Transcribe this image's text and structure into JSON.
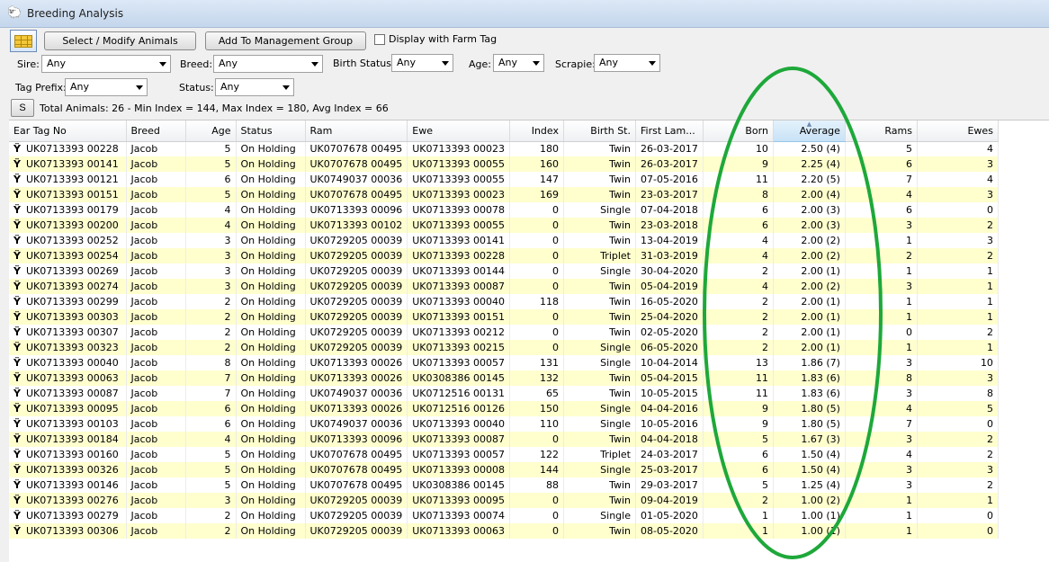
{
  "window": {
    "title": "Breeding Analysis"
  },
  "toolbar": {
    "select_label": "Select / Modify Animals",
    "add_group_label": "Add To Management Group",
    "farm_tag_label": "Display with Farm Tag"
  },
  "filters": {
    "sire_label": "Sire:",
    "sire_value": "Any",
    "breed_label": "Breed:",
    "breed_value": "Any",
    "birth_status_label": "Birth Status:",
    "birth_status_value": "Any",
    "age_label": "Age:",
    "age_value": "Any",
    "scrapie_label": "Scrapie:",
    "scrapie_value": "Any",
    "tag_prefix_label": "Tag Prefix:",
    "tag_prefix_value": "Any",
    "status_label": "Status:",
    "status_value": "Any"
  },
  "summary": {
    "s_button": "S",
    "text": "Total Animals: 26 - Min Index = 144, Max Index = 180, Avg Index = 66"
  },
  "table": {
    "columns": [
      "Ear Tag No",
      "Breed",
      "Age",
      "Status",
      "Ram",
      "Ewe",
      "Index",
      "Birth St.",
      "First Lam...",
      "Born",
      "Average",
      "Rams",
      "Ewes"
    ],
    "rows": [
      [
        "UK0713393 00228",
        "Jacob",
        "5",
        "On Holding",
        "UK0707678 00495",
        "UK0713393 00023",
        "180",
        "Twin",
        "26-03-2017",
        "10",
        "2.50 (4)",
        "5",
        "4"
      ],
      [
        "UK0713393 00141",
        "Jacob",
        "5",
        "On Holding",
        "UK0707678 00495",
        "UK0713393 00055",
        "160",
        "Twin",
        "26-03-2017",
        "9",
        "2.25 (4)",
        "6",
        "3"
      ],
      [
        "UK0713393 00121",
        "Jacob",
        "6",
        "On Holding",
        "UK0749037 00036",
        "UK0713393 00055",
        "147",
        "Twin",
        "07-05-2016",
        "11",
        "2.20 (5)",
        "7",
        "4"
      ],
      [
        "UK0713393 00151",
        "Jacob",
        "5",
        "On Holding",
        "UK0707678 00495",
        "UK0713393 00023",
        "169",
        "Twin",
        "23-03-2017",
        "8",
        "2.00 (4)",
        "4",
        "3"
      ],
      [
        "UK0713393 00179",
        "Jacob",
        "4",
        "On Holding",
        "UK0713393 00096",
        "UK0713393 00078",
        "0",
        "Single",
        "07-04-2018",
        "6",
        "2.00 (3)",
        "6",
        "0"
      ],
      [
        "UK0713393 00200",
        "Jacob",
        "4",
        "On Holding",
        "UK0713393 00102",
        "UK0713393 00055",
        "0",
        "Twin",
        "23-03-2018",
        "6",
        "2.00 (3)",
        "3",
        "2"
      ],
      [
        "UK0713393 00252",
        "Jacob",
        "3",
        "On Holding",
        "UK0729205 00039",
        "UK0713393 00141",
        "0",
        "Twin",
        "13-04-2019",
        "4",
        "2.00 (2)",
        "1",
        "3"
      ],
      [
        "UK0713393 00254",
        "Jacob",
        "3",
        "On Holding",
        "UK0729205 00039",
        "UK0713393 00228",
        "0",
        "Triplet",
        "31-03-2019",
        "4",
        "2.00 (2)",
        "2",
        "2"
      ],
      [
        "UK0713393 00269",
        "Jacob",
        "3",
        "On Holding",
        "UK0729205 00039",
        "UK0713393 00144",
        "0",
        "Single",
        "30-04-2020",
        "2",
        "2.00 (1)",
        "1",
        "1"
      ],
      [
        "UK0713393 00274",
        "Jacob",
        "3",
        "On Holding",
        "UK0729205 00039",
        "UK0713393 00087",
        "0",
        "Twin",
        "05-04-2019",
        "4",
        "2.00 (2)",
        "3",
        "1"
      ],
      [
        "UK0713393 00299",
        "Jacob",
        "2",
        "On Holding",
        "UK0729205 00039",
        "UK0713393 00040",
        "118",
        "Twin",
        "16-05-2020",
        "2",
        "2.00 (1)",
        "1",
        "1"
      ],
      [
        "UK0713393 00303",
        "Jacob",
        "2",
        "On Holding",
        "UK0729205 00039",
        "UK0713393 00151",
        "0",
        "Twin",
        "25-04-2020",
        "2",
        "2.00 (1)",
        "1",
        "1"
      ],
      [
        "UK0713393 00307",
        "Jacob",
        "2",
        "On Holding",
        "UK0729205 00039",
        "UK0713393 00212",
        "0",
        "Twin",
        "02-05-2020",
        "2",
        "2.00 (1)",
        "0",
        "2"
      ],
      [
        "UK0713393 00323",
        "Jacob",
        "2",
        "On Holding",
        "UK0729205 00039",
        "UK0713393 00215",
        "0",
        "Single",
        "06-05-2020",
        "2",
        "2.00 (1)",
        "1",
        "1"
      ],
      [
        "UK0713393 00040",
        "Jacob",
        "8",
        "On Holding",
        "UK0713393 00026",
        "UK0713393 00057",
        "131",
        "Single",
        "10-04-2014",
        "13",
        "1.86 (7)",
        "3",
        "10"
      ],
      [
        "UK0713393 00063",
        "Jacob",
        "7",
        "On Holding",
        "UK0713393 00026",
        "UK0308386 00145",
        "132",
        "Twin",
        "05-04-2015",
        "11",
        "1.83 (6)",
        "8",
        "3"
      ],
      [
        "UK0713393 00087",
        "Jacob",
        "7",
        "On Holding",
        "UK0749037 00036",
        "UK0712516 00131",
        "65",
        "Twin",
        "10-05-2015",
        "11",
        "1.83 (6)",
        "3",
        "8"
      ],
      [
        "UK0713393 00095",
        "Jacob",
        "6",
        "On Holding",
        "UK0713393 00026",
        "UK0712516 00126",
        "150",
        "Single",
        "04-04-2016",
        "9",
        "1.80 (5)",
        "4",
        "5"
      ],
      [
        "UK0713393 00103",
        "Jacob",
        "6",
        "On Holding",
        "UK0749037 00036",
        "UK0713393 00040",
        "110",
        "Single",
        "10-05-2016",
        "9",
        "1.80 (5)",
        "7",
        "0"
      ],
      [
        "UK0713393 00184",
        "Jacob",
        "4",
        "On Holding",
        "UK0713393 00096",
        "UK0713393 00087",
        "0",
        "Twin",
        "04-04-2018",
        "5",
        "1.67 (3)",
        "3",
        "2"
      ],
      [
        "UK0713393 00160",
        "Jacob",
        "5",
        "On Holding",
        "UK0707678 00495",
        "UK0713393 00057",
        "122",
        "Triplet",
        "24-03-2017",
        "6",
        "1.50 (4)",
        "4",
        "2"
      ],
      [
        "UK0713393 00326",
        "Jacob",
        "5",
        "On Holding",
        "UK0707678 00495",
        "UK0713393 00008",
        "144",
        "Single",
        "25-03-2017",
        "6",
        "1.50 (4)",
        "3",
        "3"
      ],
      [
        "UK0713393 00146",
        "Jacob",
        "5",
        "On Holding",
        "UK0707678 00495",
        "UK0308386 00145",
        "88",
        "Twin",
        "29-03-2017",
        "5",
        "1.25 (4)",
        "3",
        "2"
      ],
      [
        "UK0713393 00276",
        "Jacob",
        "3",
        "On Holding",
        "UK0729205 00039",
        "UK0713393 00095",
        "0",
        "Twin",
        "09-04-2019",
        "2",
        "1.00 (2)",
        "1",
        "1"
      ],
      [
        "UK0713393 00279",
        "Jacob",
        "2",
        "On Holding",
        "UK0729205 00039",
        "UK0713393 00074",
        "0",
        "Single",
        "01-05-2020",
        "1",
        "1.00 (1)",
        "1",
        "0"
      ],
      [
        "UK0713393 00306",
        "Jacob",
        "2",
        "On Holding",
        "UK0729205 00039",
        "UK0713393 00063",
        "0",
        "Twin",
        "08-05-2020",
        "1",
        "1.00 (1)",
        "1",
        "0"
      ]
    ]
  },
  "colors": {
    "row_alt": "#ffffce",
    "sorted_header": "#c8e2f6",
    "annotation_oval": "#1ea83a"
  },
  "icons": {
    "app": "sheep-icon",
    "grid": "grid-view-icon",
    "row": "sheep-tag-icon"
  }
}
